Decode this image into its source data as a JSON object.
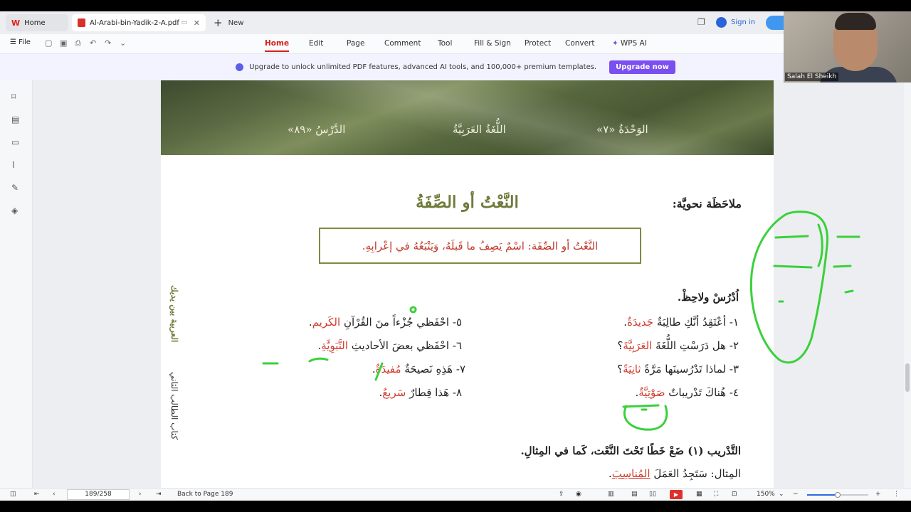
{
  "tabs": [
    {
      "label": "Home"
    },
    {
      "label": "Al-Arabi-bin-Yadik-2-A.pdf"
    }
  ],
  "new_tab_label": "New",
  "sign_in_label": "Sign in",
  "menu": {
    "file_label": "File",
    "tabs": [
      "Home",
      "Edit",
      "Page",
      "Comment",
      "Tool",
      "Fill & Sign",
      "Protect",
      "Convert",
      "WPS AI"
    ],
    "active": "Home"
  },
  "promo": {
    "text": "Upgrade to unlock unlimited PDF features, advanced AI tools, and 100,000+ premium templates.",
    "button": "Upgrade now"
  },
  "webcam": {
    "name": "Salah El Sheikh"
  },
  "document": {
    "header": {
      "unit": "الوَحْدَةُ «٧»",
      "subject": "اللُّغَةُ العَرَبِيَّةُ",
      "lesson": "الدَّرْسُ «٨٩»"
    },
    "grammar_note": "ملاحَظَة نحويَّة:",
    "title": "النَّعْتُ أو الصِّفَةُ",
    "definition": "النَّعْتُ أو الصِّفَة: اسْمٌ يَصِفُ ما قَبلَهُ، وَيَتْبَعُهُ في إعْرابِهِ.",
    "study": "اُدْرُسْ ولاحِظْ.",
    "sentences_right": [
      {
        "text": "١- أعْتَقِدُ أنَّكِ طالِبَةٌ ",
        "highlight": "جَديدَةٌ",
        "end": "."
      },
      {
        "text": "٢- هل دَرَسْتِ اللُّغَةَ ",
        "highlight": "العَرَبِيَّةَ",
        "end": "؟"
      },
      {
        "text": "٣- لماذا تَدْرُسينَها مَرَّةً ",
        "highlight": "ثانِيَةً",
        "end": "؟"
      },
      {
        "text": "٤- هُناكَ تَدْريباتٌ ",
        "highlight": "صَوْتِيَّةٌ",
        "end": "."
      }
    ],
    "sentences_left": [
      {
        "text": "٥- احْفَظي جُزْءاً منَ القُرْآنِ ",
        "highlight": "الكَريم",
        "end": "."
      },
      {
        "text": "٦- احْفَظي بعضَ الأحاديثِ ",
        "highlight": "النَّبَوِيَّةِ",
        "end": "."
      },
      {
        "text": "٧- هَذِهِ نَصيحَةٌ ",
        "highlight": "مُفيدَةٌ",
        "end": "."
      },
      {
        "text": "٨- هَذا قِطارٌ ",
        "highlight": "سَريعٌ",
        "end": "."
      }
    ],
    "exercise": "التَّدْريب (١) ضَعْ خَطًا تَحْتَ النَّعْت، كَما في المِثالِ.",
    "example_prefix": "المِثال: سَتَجِدُ العَمَلَ ",
    "example_highlight": "المُناسِبَ",
    "example_end": ".",
    "side_title": "العربية بين يديك",
    "side_sub": "كتاب الطالب الثاني"
  },
  "status": {
    "page_input": "189/258",
    "back_label": "Back to Page 189",
    "zoom": "150%",
    "zoom_fraction": 0.5
  }
}
